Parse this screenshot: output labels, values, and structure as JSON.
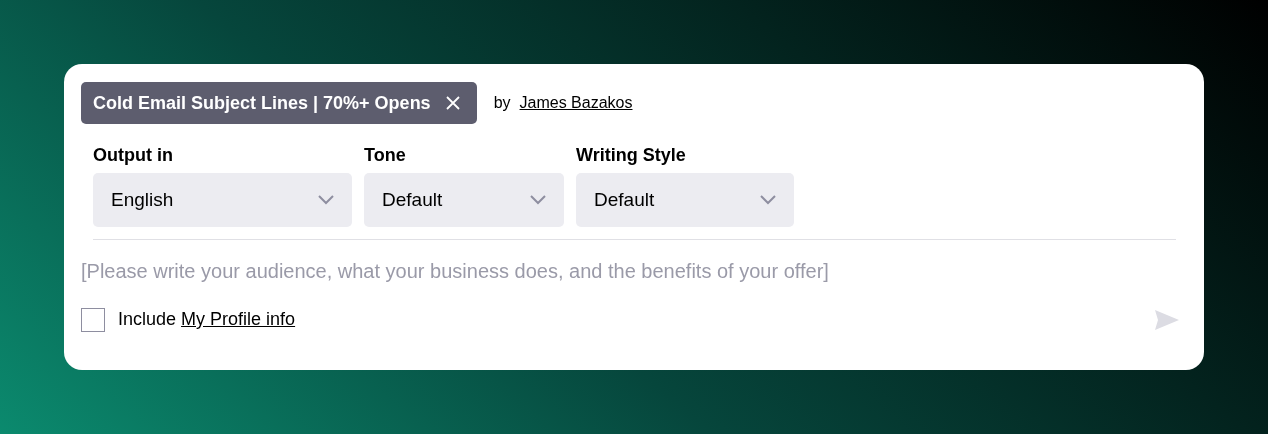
{
  "prompt_tag": {
    "title": "Cold Email Subject Lines | 70%+ Opens"
  },
  "author": {
    "prefix": "by",
    "name": "James Bazakos"
  },
  "selects": [
    {
      "label": "Output in",
      "value": "English"
    },
    {
      "label": "Tone",
      "value": "Default"
    },
    {
      "label": "Writing Style",
      "value": "Default"
    }
  ],
  "prompt_input": {
    "placeholder": "[Please write your audience, what your business does, and the benefits of your offer]"
  },
  "include_profile": {
    "checked": false,
    "label": "Include",
    "link": "My Profile info"
  },
  "send_button": {
    "disabled": true
  }
}
